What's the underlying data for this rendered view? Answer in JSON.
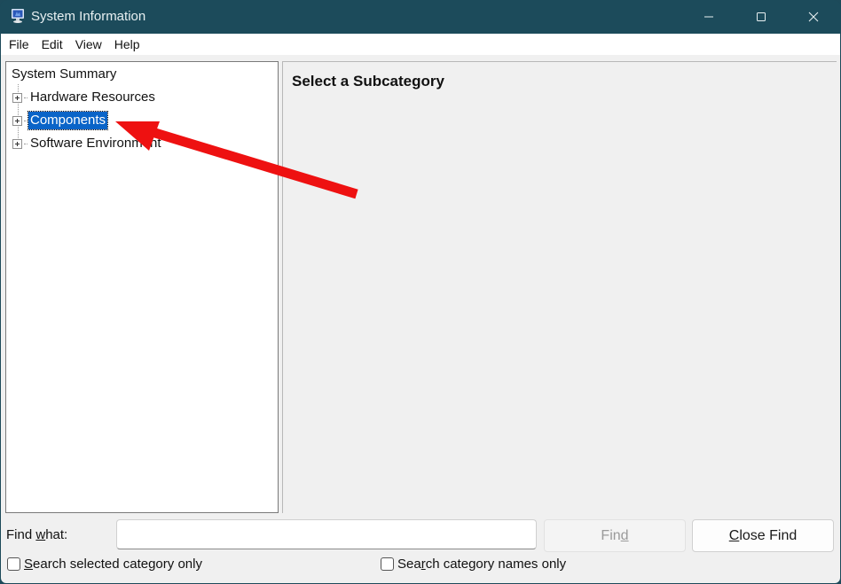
{
  "window": {
    "title": "System Information",
    "icon": "system-information-icon",
    "controls": {
      "minimize": "minimize-icon",
      "maximize": "maximize-icon",
      "close": "close-icon"
    }
  },
  "menubar": {
    "items": [
      {
        "label": "File"
      },
      {
        "label": "Edit"
      },
      {
        "label": "View"
      },
      {
        "label": "Help"
      }
    ]
  },
  "tree": {
    "root": "System Summary",
    "nodes": [
      {
        "label": "Hardware Resources",
        "expandable": true,
        "selected": false
      },
      {
        "label": "Components",
        "expandable": true,
        "selected": true
      },
      {
        "label": "Software Environment",
        "expandable": true,
        "selected": false
      }
    ]
  },
  "detail": {
    "heading": "Select a Subcategory"
  },
  "find": {
    "label_pre": "Find ",
    "label_accel": "w",
    "label_post": "hat:",
    "input_value": "",
    "input_placeholder": "",
    "find_button": {
      "pre": "Fin",
      "accel": "d",
      "post": "",
      "enabled": false
    },
    "close_button": {
      "pre": "",
      "accel": "C",
      "post": "lose Find"
    },
    "options": [
      {
        "pre": "",
        "accel": "S",
        "post": "earch selected category only",
        "checked": false
      },
      {
        "pre": "Sea",
        "accel": "r",
        "post": "ch category names only",
        "checked": false
      }
    ]
  },
  "annotation": {
    "type": "arrow",
    "color": "#ee1111",
    "points_to": "Components"
  },
  "colors": {
    "titlebar": "#1c4b5b",
    "selection": "#0a64c8"
  }
}
